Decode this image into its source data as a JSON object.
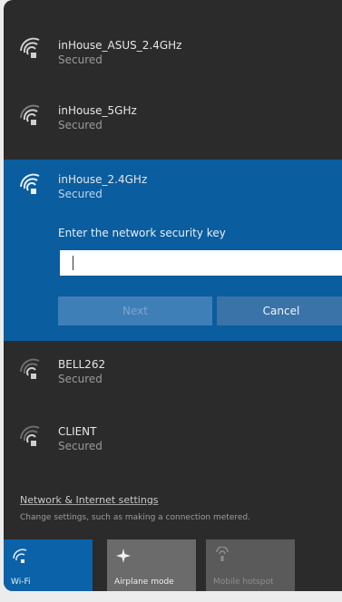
{
  "networks": [
    {
      "name": "inHouse_ASUS_2.4GHz",
      "status": "Secured"
    },
    {
      "name": "inHouse_5GHz",
      "status": "Secured"
    },
    {
      "name": "inHouse_2.4GHz",
      "status": "Secured"
    },
    {
      "name": "BELL262",
      "status": "Secured"
    },
    {
      "name": "CLIENT",
      "status": "Secured"
    }
  ],
  "connect": {
    "key_label": "Enter the network security key",
    "key_value": "",
    "next_label": "Next",
    "cancel_label": "Cancel"
  },
  "settings": {
    "link": "Network & Internet settings",
    "description": "Change settings, such as making a connection metered."
  },
  "tiles": [
    {
      "label": "Wi-Fi",
      "icon": "wifi-icon"
    },
    {
      "label": "Airplane mode",
      "icon": "airplane-icon"
    },
    {
      "label": "Mobile hotspot",
      "icon": "mobile-hotspot-icon"
    }
  ],
  "colors": {
    "panel_bg": "#2b2b2b",
    "selected_bg": "#0a5d9e",
    "accent": "#0b62a8"
  }
}
